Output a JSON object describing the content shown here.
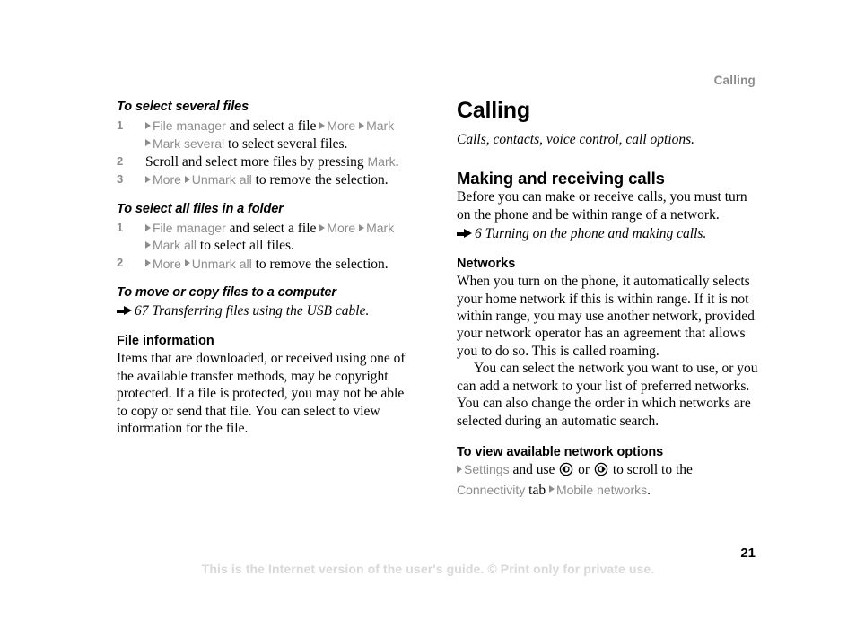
{
  "running_header": "Calling",
  "page_number": "21",
  "footer_note": "This is the Internet version of the user's guide. © Print only for private use.",
  "colors": {
    "ui_term": "#8c8c8c",
    "body_text": "#000000",
    "footer": "#d8d8d8",
    "running_header": "#8c8c8c"
  },
  "left_column": {
    "proc1": {
      "heading": "To select several files",
      "steps": [
        {
          "num": "1",
          "parts": [
            {
              "type": "tri-icon",
              "name": "nav-triangle-icon"
            },
            {
              "type": "ui",
              "text": "File manager"
            },
            {
              "type": "text",
              "text": " and select a file "
            },
            {
              "type": "tri-icon",
              "name": "nav-triangle-icon"
            },
            {
              "type": "ui",
              "text": "More "
            },
            {
              "type": "tri-icon",
              "name": "nav-triangle-icon"
            },
            {
              "type": "ui",
              "text": "Mark"
            }
          ],
          "continuation": [
            {
              "type": "tri-icon",
              "name": "nav-triangle-icon"
            },
            {
              "type": "ui",
              "text": "Mark several"
            },
            {
              "type": "text",
              "text": " to select several files."
            }
          ]
        },
        {
          "num": "2",
          "parts": [
            {
              "type": "text",
              "text": "Scroll and select more files by pressing "
            },
            {
              "type": "ui",
              "text": "Mark"
            },
            {
              "type": "text",
              "text": "."
            }
          ]
        },
        {
          "num": "3",
          "parts": [
            {
              "type": "tri-icon",
              "name": "nav-triangle-icon"
            },
            {
              "type": "ui",
              "text": "More "
            },
            {
              "type": "tri-icon",
              "name": "nav-triangle-icon"
            },
            {
              "type": "ui",
              "text": "Unmark all"
            },
            {
              "type": "text",
              "text": " to remove the selection."
            }
          ]
        }
      ]
    },
    "proc2": {
      "heading": "To select all files in a folder",
      "steps": [
        {
          "num": "1",
          "parts": [
            {
              "type": "tri-icon",
              "name": "nav-triangle-icon"
            },
            {
              "type": "ui",
              "text": "File manager"
            },
            {
              "type": "text",
              "text": " and select a file "
            },
            {
              "type": "tri-icon",
              "name": "nav-triangle-icon"
            },
            {
              "type": "ui",
              "text": "More "
            },
            {
              "type": "tri-icon",
              "name": "nav-triangle-icon"
            },
            {
              "type": "ui",
              "text": "Mark"
            }
          ],
          "continuation": [
            {
              "type": "tri-icon",
              "name": "nav-triangle-icon"
            },
            {
              "type": "ui",
              "text": "Mark all"
            },
            {
              "type": "text",
              "text": " to select all files."
            }
          ]
        },
        {
          "num": "2",
          "parts": [
            {
              "type": "tri-icon",
              "name": "nav-triangle-icon"
            },
            {
              "type": "ui",
              "text": "More "
            },
            {
              "type": "tri-icon",
              "name": "nav-triangle-icon"
            },
            {
              "type": "ui",
              "text": "Unmark all"
            },
            {
              "type": "text",
              "text": " to remove the selection."
            }
          ]
        }
      ]
    },
    "proc3": {
      "heading": "To move or copy files to a computer",
      "xref": "67 Transferring files using the USB cable."
    },
    "file_info": {
      "heading": "File information",
      "body": "Items that are downloaded, or received using one of the available transfer methods, may be copyright protected. If a file is protected, you may not be able to copy or send that file. You can select to view information for the file."
    }
  },
  "right_column": {
    "chapter_title": "Calling",
    "chapter_subtitle": "Calls, contacts, voice control, call options.",
    "section": {
      "heading": "Making and receiving calls",
      "body": "Before you can make or receive calls, you must turn on the phone and be within range of a network.",
      "xref": "6 Turning on the phone and making calls."
    },
    "networks": {
      "heading": "Networks",
      "para1": "When you turn on the phone, it automatically selects your home network if this is within range. If it is not within range, you may use another network, provided your network operator has an agreement that allows you to do so. This is called roaming.",
      "para2": "You can select the network you want to use, or you can add a network to your list of preferred networks. You can also change the order in which networks are selected during an automatic search."
    },
    "proc": {
      "heading": "To view available network options",
      "parts": [
        {
          "type": "tri-icon",
          "name": "nav-triangle-icon"
        },
        {
          "type": "ui",
          "text": "Settings"
        },
        {
          "type": "text",
          "text": " and use "
        },
        {
          "type": "navkey",
          "name": "nav-key-left-icon"
        },
        {
          "type": "text",
          "text": " or "
        },
        {
          "type": "navkey",
          "name": "nav-key-right-icon"
        },
        {
          "type": "text",
          "text": " to scroll to the "
        },
        {
          "type": "ui-break",
          "text": "Connectivity"
        },
        {
          "type": "text",
          "text": " tab "
        },
        {
          "type": "tri-icon",
          "name": "nav-triangle-icon"
        },
        {
          "type": "ui",
          "text": "Mobile networks"
        },
        {
          "type": "text",
          "text": "."
        }
      ]
    }
  }
}
